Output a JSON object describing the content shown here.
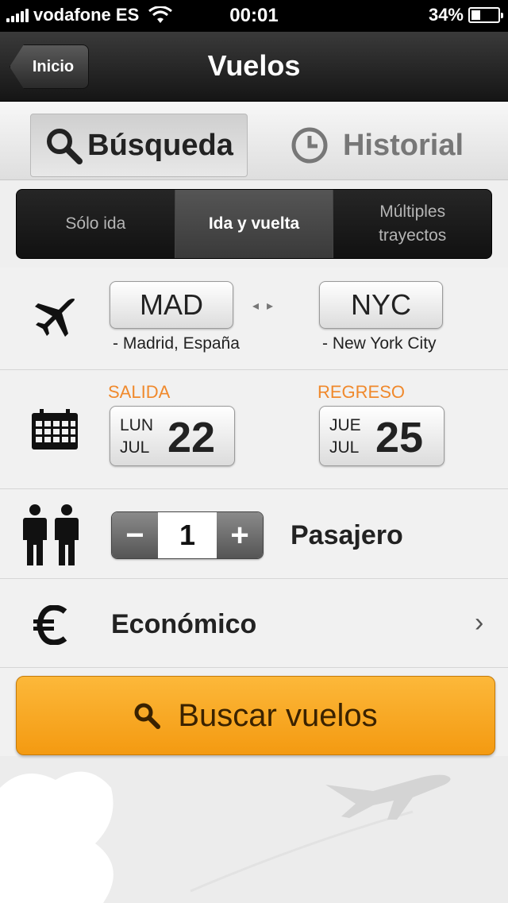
{
  "status_bar": {
    "carrier": "vodafone ES",
    "time": "00:01",
    "battery": "34%",
    "battery_level": 0.34
  },
  "navbar": {
    "back_label": "Inicio",
    "title": "Vuelos"
  },
  "tabs": {
    "search_label": "Búsqueda",
    "history_label": "Historial"
  },
  "trip_types": {
    "one_way": "Sólo ida",
    "round_trip": "Ida y vuelta",
    "multi_line1": "Múltiples",
    "multi_line2": "trayectos",
    "selected": "Ida y vuelta"
  },
  "route": {
    "origin_code": "MAD",
    "origin_name": "- Madrid, España",
    "destination_code": "NYC",
    "destination_name": "- New York City"
  },
  "dates": {
    "departure_label": "SALIDA",
    "departure_weekday": "LUN",
    "departure_month": "JUL",
    "departure_day": "22",
    "return_label": "REGRESO",
    "return_weekday": "JUE",
    "return_month": "JUL",
    "return_day": "25"
  },
  "passengers": {
    "minus": "−",
    "count": "1",
    "plus": "+",
    "label": "Pasajero"
  },
  "cabin": {
    "label": "Económico"
  },
  "search_button": {
    "label": "Buscar vuelos"
  },
  "colors": {
    "accent_orange": "#f0892c",
    "search_button": "#f7a320"
  },
  "icons": [
    "search-icon",
    "clock-icon",
    "plane-icon",
    "calendar-icon",
    "passengers-icon",
    "euro-icon",
    "chevron-right-icon"
  ]
}
